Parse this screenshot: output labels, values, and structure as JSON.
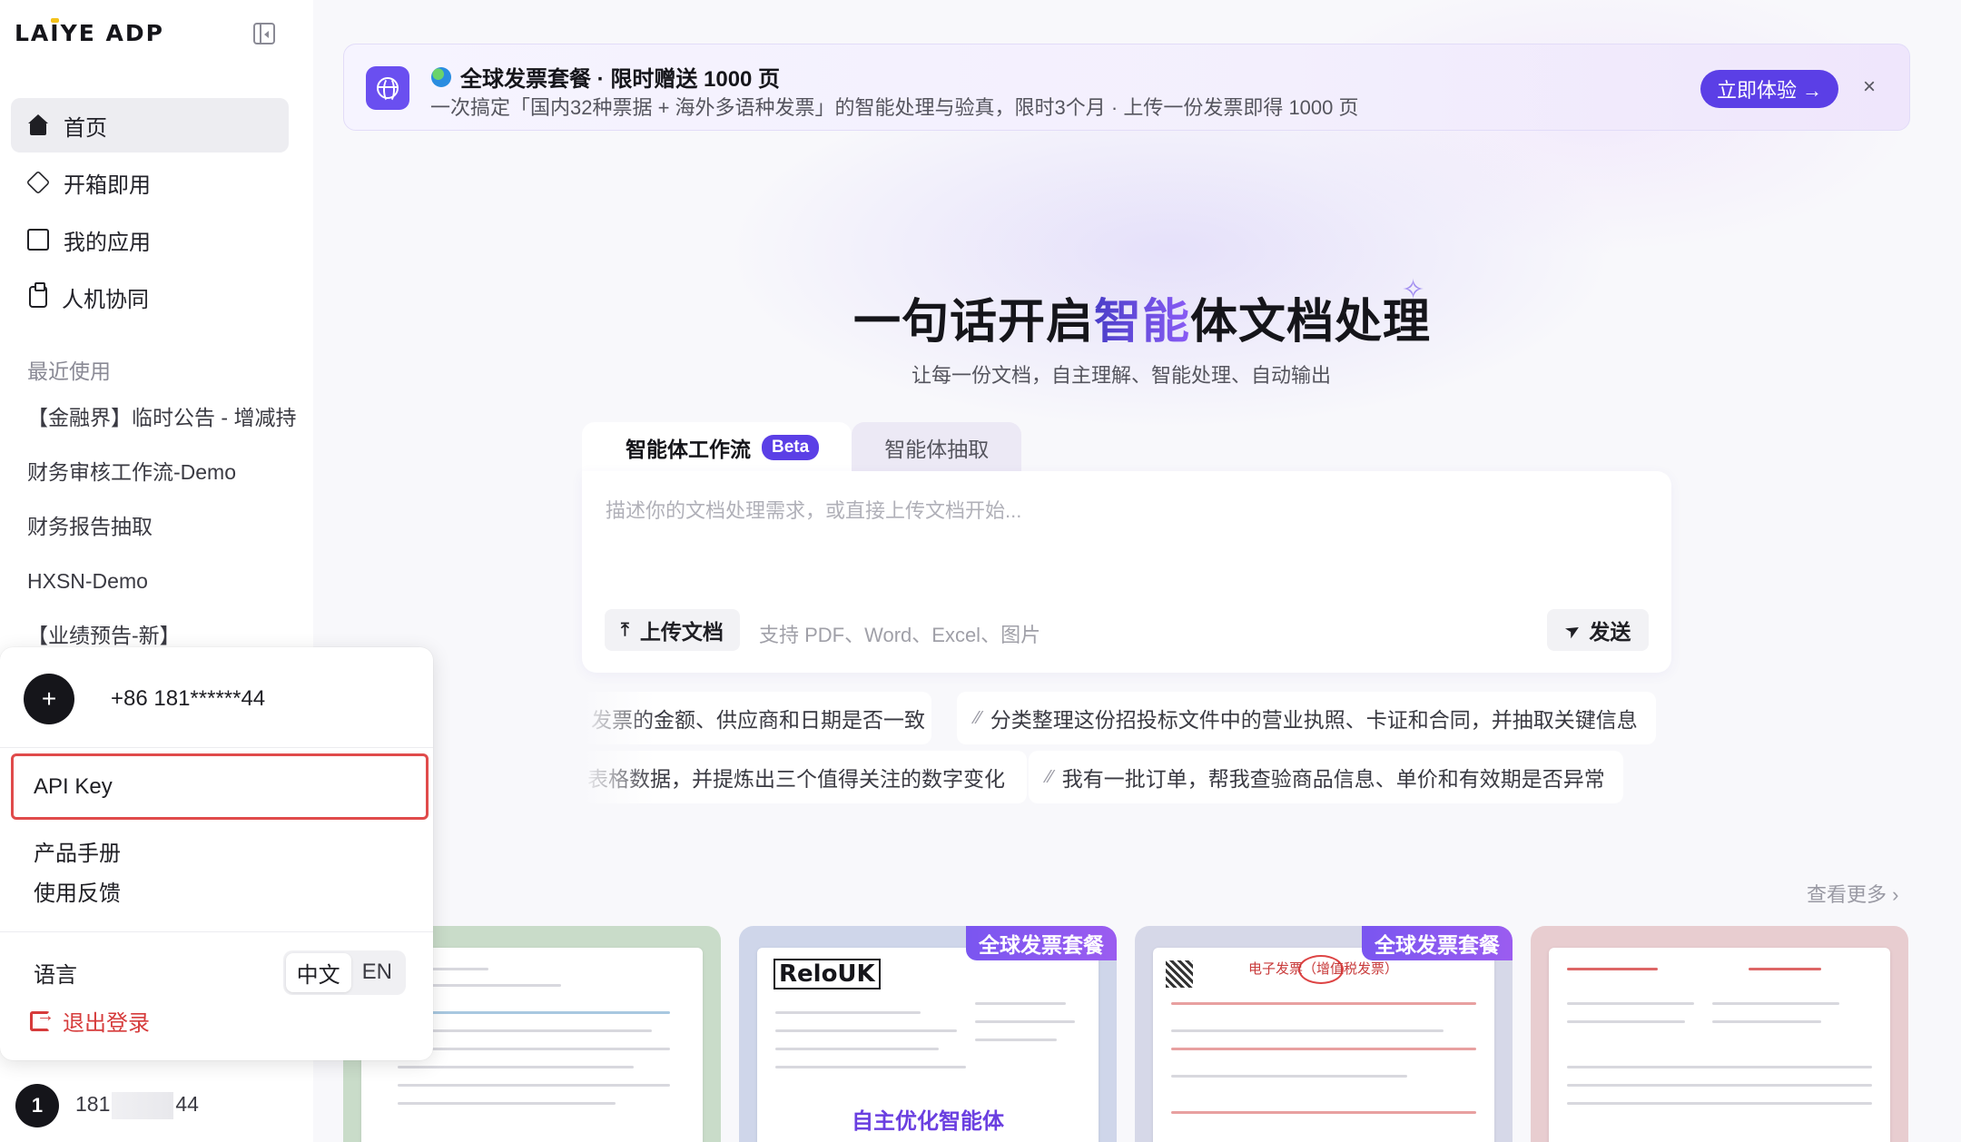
{
  "sidebar": {
    "logo": "LAIYE ADP",
    "nav": [
      {
        "label": "首页",
        "icon": "home-icon",
        "active": true
      },
      {
        "label": "开箱即用",
        "icon": "box-icon",
        "active": false
      },
      {
        "label": "我的应用",
        "icon": "grid-icon",
        "active": false
      },
      {
        "label": "人机协同",
        "icon": "clipboard-icon",
        "active": false
      }
    ],
    "recent_title": "最近使用",
    "recent": [
      "【金融界】临时公告 - 增减持",
      "财务审核工作流-Demo",
      "财务报告抽取",
      "HXSN-Demo",
      "【业绩预告-新】"
    ],
    "user": {
      "avatar_letter": "1",
      "phone_prefix": "181",
      "phone_suffix": "44"
    }
  },
  "popup": {
    "avatar_symbol": "+",
    "phone": "+86 181******44",
    "items": [
      "API Key",
      "产品手册",
      "使用反馈"
    ],
    "language_label": "语言",
    "languages": [
      "中文",
      "EN"
    ],
    "selected_language": "中文",
    "logout": "退出登录",
    "highlight_color": "#e04b4b"
  },
  "banner": {
    "title": "全球发票套餐 · 限时赠送 1000 页",
    "subtitle": "一次搞定「国内32种票据 + 海外多语种发票」的智能处理与验真，限时3个月 · 上传一份发票即得 1000 页",
    "cta": "立即体验 →",
    "close": "×",
    "accent_color": "#5b3fe6"
  },
  "hero": {
    "title_prefix": "一句话开启",
    "title_highlight": "智能",
    "title_suffix": "体文档处理",
    "subtitle": "让每一份文档，自主理解、智能处理、自动输出"
  },
  "composer": {
    "tabs": [
      {
        "label": "智能体工作流",
        "badge": "Beta",
        "active": true
      },
      {
        "label": "智能体抽取",
        "active": false
      }
    ],
    "placeholder": "描述你的文档处理需求，或直接上传文档开始...",
    "upload_label": "上传文档",
    "upload_hint": "支持 PDF、Word、Excel、图片",
    "send_label": "发送"
  },
  "suggestions": {
    "row1": [
      "发票的金额、供应商和日期是否一致",
      "分类整理这份招投标文件中的营业执照、卡证和合同，并抽取关键信息"
    ],
    "row2": [
      "表格数据，并提炼出三个值得关注的数字变化",
      "我有一批订单，帮我查验商品信息、单价和有效期是否异常"
    ]
  },
  "see_more": "查看更多 ›",
  "cards": [
    {
      "tag": "",
      "caption": "",
      "bg": "#c9dcc9"
    },
    {
      "tag": "全球发票套餐",
      "caption": "自主优化智能体",
      "bg": "#cfd6ea",
      "doc_logo": "ReloUK"
    },
    {
      "tag": "全球发票套餐",
      "caption": "",
      "bg": "#d6d8e8",
      "doc_title": "电子发票（增值税发票）"
    },
    {
      "tag": "",
      "caption": "",
      "bg": "#e8cdd0"
    }
  ]
}
